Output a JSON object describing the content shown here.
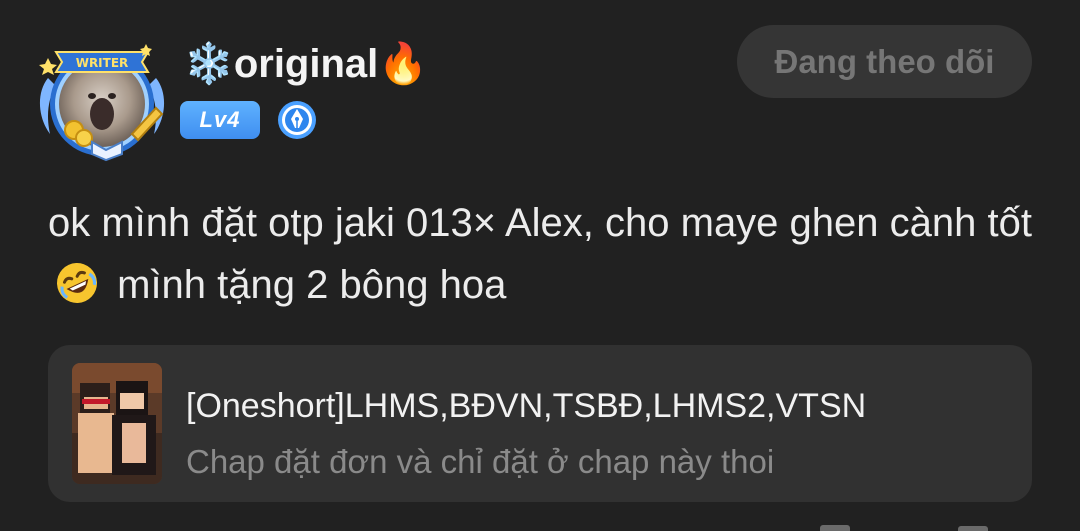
{
  "user": {
    "name": "original",
    "name_prefix_emoji": "❄️",
    "name_suffix_emoji": "🔥",
    "level": "Lv4",
    "avatar_badge": "WRITER"
  },
  "follow_button": {
    "label": "Đang theo dõi"
  },
  "post": {
    "text_before_emoji": "ok mình đặt otp jaki 013× Alex, cho maye ghen cành tốt",
    "text_after_emoji": "mình tặng 2 bông hoa",
    "emoji": "rolling-on-floor-laughing"
  },
  "linked_story": {
    "title": "[Oneshort]LHMS,BĐVN,TSBĐ,LHMS2,VTSN",
    "subtitle": "Chap đặt đơn và chỉ đặt ở chap này thoi"
  },
  "colors": {
    "background": "#212121",
    "card": "#313131",
    "button": "#353535",
    "level_badge": "#4a9cf5",
    "muted_text": "#8a8a8a"
  }
}
